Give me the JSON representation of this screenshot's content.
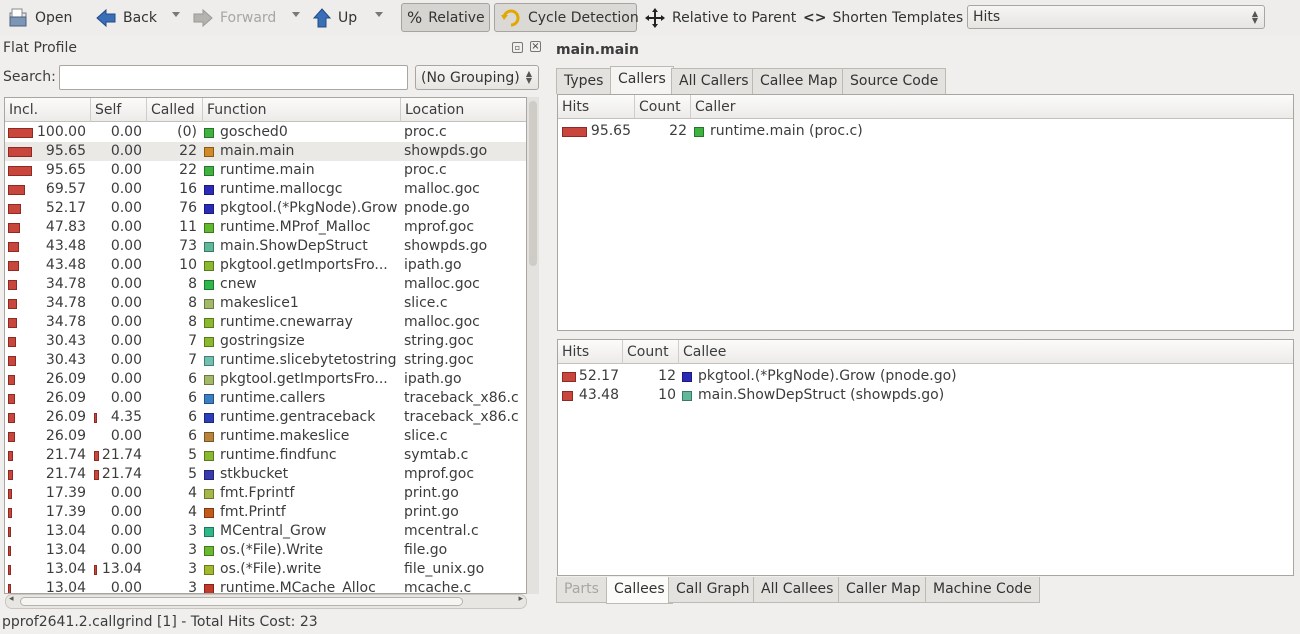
{
  "toolbar": {
    "open": "Open",
    "back": "Back",
    "forward": "Forward",
    "up": "Up",
    "relative": "Relative",
    "cycle_detection": "Cycle Detection",
    "relative_to_parent": "Relative to Parent",
    "shorten_templates": "Shorten Templates",
    "event_type": "Hits"
  },
  "flat_profile": {
    "title": "Flat Profile",
    "search_label": "Search:",
    "search_value": "",
    "grouping": "(No Grouping)",
    "columns": [
      "Incl.",
      "Self",
      "Called",
      "Function",
      "Location"
    ],
    "rows": [
      {
        "incl": "100.00",
        "self": "0.00",
        "called": "(0)",
        "function": "gosched0",
        "location": "proc.c",
        "color": "#3fb33f",
        "incl_frac": 1.0,
        "self_frac": 0
      },
      {
        "incl": "95.65",
        "self": "0.00",
        "called": "22",
        "function": "main.main",
        "location": "showpds.go",
        "color": "#d08a28",
        "incl_frac": 0.9565,
        "self_frac": 0,
        "selected": true
      },
      {
        "incl": "95.65",
        "self": "0.00",
        "called": "22",
        "function": "runtime.main",
        "location": "proc.c",
        "color": "#3fb33f",
        "incl_frac": 0.9565,
        "self_frac": 0
      },
      {
        "incl": "69.57",
        "self": "0.00",
        "called": "16",
        "function": "runtime.mallocgc",
        "location": "malloc.goc",
        "color": "#2c2ab9",
        "incl_frac": 0.6957,
        "self_frac": 0
      },
      {
        "incl": "52.17",
        "self": "0.00",
        "called": "76",
        "function": "pkgtool.(*PkgNode).Grow",
        "location": "pnode.go",
        "color": "#2c2ab9",
        "incl_frac": 0.5217,
        "self_frac": 0
      },
      {
        "incl": "47.83",
        "self": "0.00",
        "called": "11",
        "function": "runtime.MProf_Malloc",
        "location": "mprof.goc",
        "color": "#5fb82e",
        "incl_frac": 0.4783,
        "self_frac": 0
      },
      {
        "incl": "43.48",
        "self": "0.00",
        "called": "73",
        "function": "main.ShowDepStruct",
        "location": "showpds.go",
        "color": "#5fb89a",
        "incl_frac": 0.4348,
        "self_frac": 0
      },
      {
        "incl": "43.48",
        "self": "0.00",
        "called": "10",
        "function": "pkgtool.getImportsFro...",
        "location": "ipath.go",
        "color": "#8ab82e",
        "incl_frac": 0.4348,
        "self_frac": 0
      },
      {
        "incl": "34.78",
        "self": "0.00",
        "called": "8",
        "function": "cnew",
        "location": "malloc.goc",
        "color": "#2eb84a",
        "incl_frac": 0.3478,
        "self_frac": 0
      },
      {
        "incl": "34.78",
        "self": "0.00",
        "called": "8",
        "function": "makeslice1",
        "location": "slice.c",
        "color": "#a4b86a",
        "incl_frac": 0.3478,
        "self_frac": 0
      },
      {
        "incl": "34.78",
        "self": "0.00",
        "called": "8",
        "function": "runtime.cnewarray",
        "location": "malloc.goc",
        "color": "#8ab82e",
        "incl_frac": 0.3478,
        "self_frac": 0
      },
      {
        "incl": "30.43",
        "self": "0.00",
        "called": "7",
        "function": "gostringsize",
        "location": "string.goc",
        "color": "#8ab82e",
        "incl_frac": 0.3043,
        "self_frac": 0
      },
      {
        "incl": "30.43",
        "self": "0.00",
        "called": "7",
        "function": "runtime.slicebytetostring",
        "location": "string.goc",
        "color": "#6fc0b0",
        "incl_frac": 0.3043,
        "self_frac": 0
      },
      {
        "incl": "26.09",
        "self": "0.00",
        "called": "6",
        "function": "pkgtool.getImportsFro...",
        "location": "ipath.go",
        "color": "#a4b86a",
        "incl_frac": 0.2609,
        "self_frac": 0
      },
      {
        "incl": "26.09",
        "self": "0.00",
        "called": "6",
        "function": "runtime.callers",
        "location": "traceback_x86.c",
        "color": "#3a7fc4",
        "incl_frac": 0.2609,
        "self_frac": 0
      },
      {
        "incl": "26.09",
        "self": "4.35",
        "called": "6",
        "function": "runtime.gentraceback",
        "location": "traceback_x86.c",
        "color": "#2c3fb9",
        "incl_frac": 0.2609,
        "self_frac": 0.0435
      },
      {
        "incl": "26.09",
        "self": "0.00",
        "called": "6",
        "function": "runtime.makeslice",
        "location": "slice.c",
        "color": "#b8843a",
        "incl_frac": 0.2609,
        "self_frac": 0
      },
      {
        "incl": "21.74",
        "self": "21.74",
        "called": "5",
        "function": "runtime.findfunc",
        "location": "symtab.c",
        "color": "#8ab82e",
        "incl_frac": 0.2174,
        "self_frac": 0.2174
      },
      {
        "incl": "21.74",
        "self": "21.74",
        "called": "5",
        "function": "stkbucket",
        "location": "mprof.goc",
        "color": "#3a3ab0",
        "incl_frac": 0.2174,
        "self_frac": 0.2174
      },
      {
        "incl": "17.39",
        "self": "0.00",
        "called": "4",
        "function": "fmt.Fprintf",
        "location": "print.go",
        "color": "#a4b84a",
        "incl_frac": 0.1739,
        "self_frac": 0
      },
      {
        "incl": "17.39",
        "self": "0.00",
        "called": "4",
        "function": "fmt.Printf",
        "location": "print.go",
        "color": "#c45a1a",
        "incl_frac": 0.1739,
        "self_frac": 0
      },
      {
        "incl": "13.04",
        "self": "0.00",
        "called": "3",
        "function": "MCentral_Grow",
        "location": "mcentral.c",
        "color": "#2eb88a",
        "incl_frac": 0.1304,
        "self_frac": 0
      },
      {
        "incl": "13.04",
        "self": "0.00",
        "called": "3",
        "function": "os.(*File).Write",
        "location": "file.go",
        "color": "#6ab82e",
        "incl_frac": 0.1304,
        "self_frac": 0
      },
      {
        "incl": "13.04",
        "self": "13.04",
        "called": "3",
        "function": "os.(*File).write",
        "location": "file_unix.go",
        "color": "#a4b82e",
        "incl_frac": 0.1304,
        "self_frac": 0.1304
      },
      {
        "incl": "13.04",
        "self": "0.00",
        "called": "3",
        "function": "runtime.MCache_Alloc",
        "location": "mcache.c",
        "color": "#c43a2a",
        "incl_frac": 0.1304,
        "self_frac": 0
      }
    ]
  },
  "detail": {
    "title": "main.main",
    "top_tabs": [
      "Types",
      "Callers",
      "All Callers",
      "Callee Map",
      "Source Code"
    ],
    "top_active": 1,
    "callers": {
      "columns": [
        "Hits",
        "Count",
        "Caller"
      ],
      "rows": [
        {
          "hits": "95.65",
          "count": "22",
          "name": "runtime.main (proc.c)",
          "color": "#3fb33f",
          "frac": 0.9565
        }
      ]
    },
    "callees": {
      "columns": [
        "Hits",
        "Count",
        "Callee"
      ],
      "rows": [
        {
          "hits": "52.17",
          "count": "12",
          "name": "pkgtool.(*PkgNode).Grow (pnode.go)",
          "color": "#2c2ab9",
          "frac": 0.5217
        },
        {
          "hits": "43.48",
          "count": "10",
          "name": "main.ShowDepStruct (showpds.go)",
          "color": "#5fb89a",
          "frac": 0.4348
        }
      ]
    },
    "bottom_tabs": [
      "Parts",
      "Callees",
      "Call Graph",
      "All Callees",
      "Caller Map",
      "Machine Code"
    ],
    "bottom_active": 1
  },
  "status": "pprof2641.2.callgrind [1] - Total Hits Cost: 23"
}
